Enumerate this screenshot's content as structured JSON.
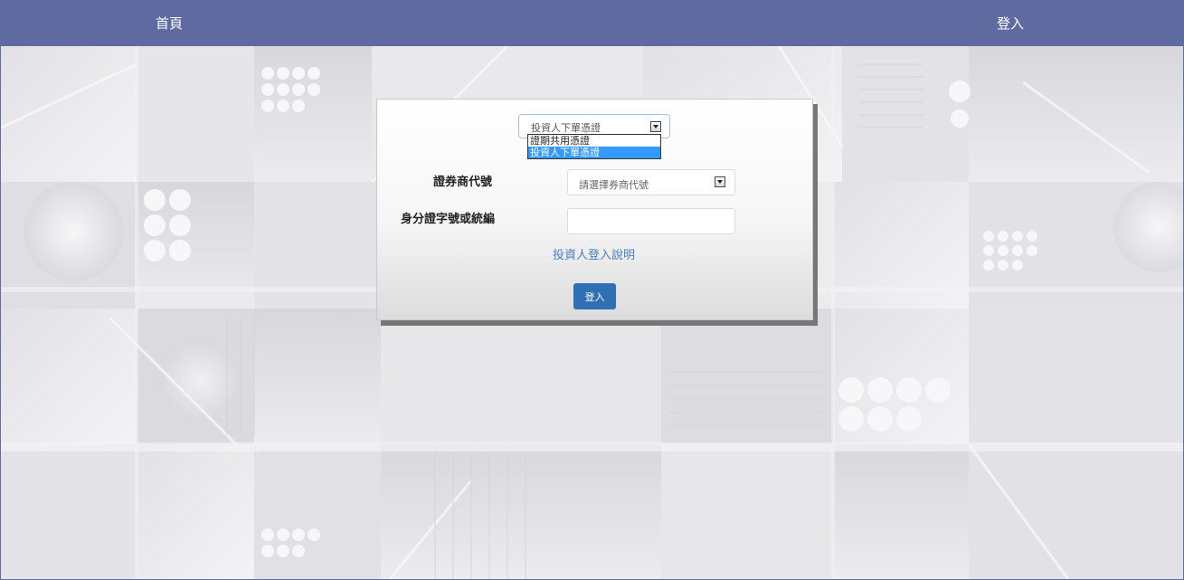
{
  "nav": {
    "home_label": "首頁",
    "login_label": "登入"
  },
  "form": {
    "certificate_select": {
      "selected": "投資人下單憑證",
      "options": [
        "證期共用憑證",
        "投資人下單憑證"
      ],
      "highlighted_index": 1
    },
    "broker_label": "證券商代號",
    "broker_placeholder": "請選擇券商代號",
    "id_label": "身分證字號或統編",
    "id_value": "",
    "help_link": "投資人登入說明",
    "login_button": "登入"
  },
  "colors": {
    "topbar": "#5e6aa0",
    "login_button": "#2f6fb3",
    "link": "#4a7fc0",
    "option_highlight": "#3399ff"
  },
  "icons": [
    "dropdown-arrow-icon"
  ]
}
